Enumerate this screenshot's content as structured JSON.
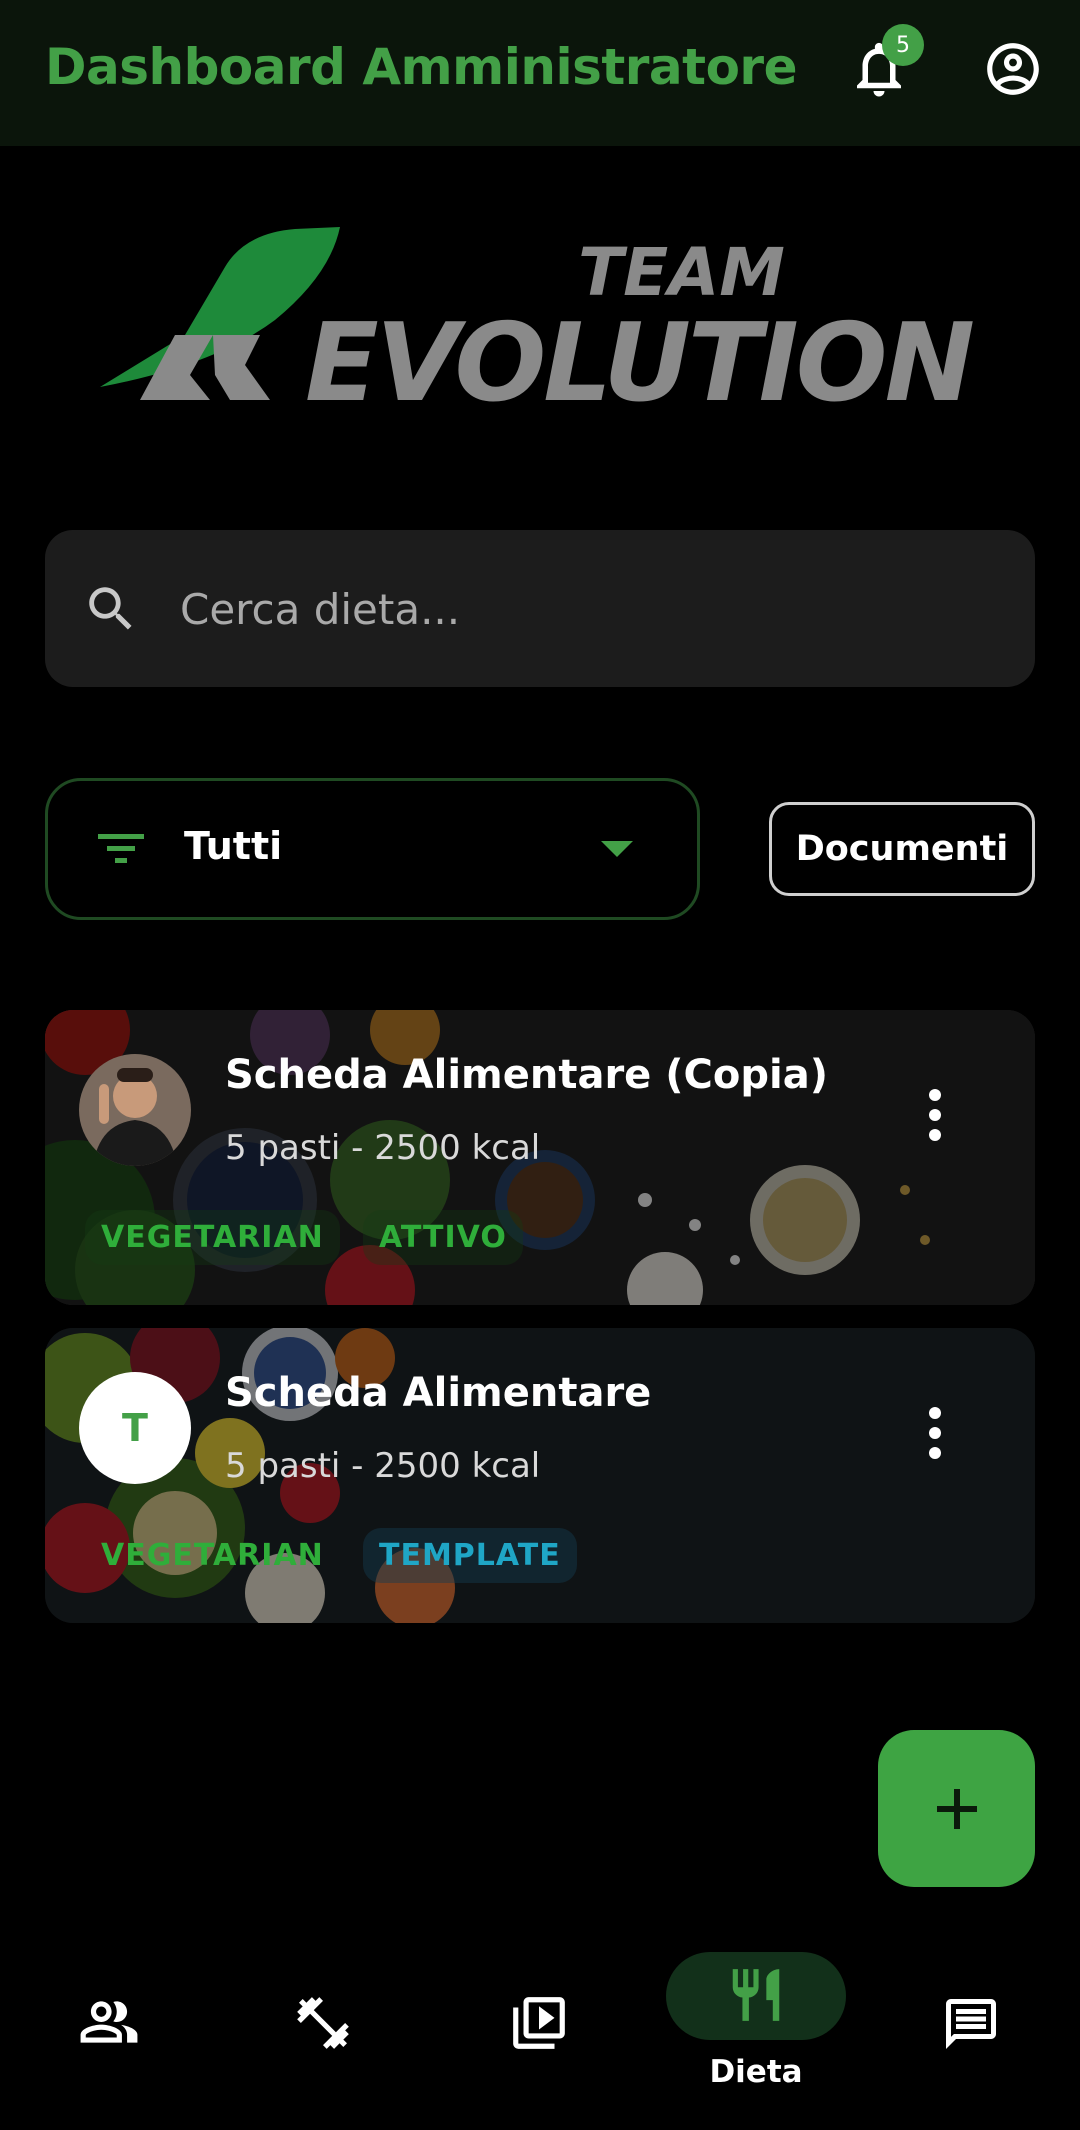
{
  "app_bar": {
    "title": "Dashboard Amministratore",
    "notification_count": "5"
  },
  "logo": {
    "team_text": "TEAM",
    "brand_text": "EVOLUTION",
    "brand_initial": "R"
  },
  "search": {
    "placeholder": "Cerca dieta..."
  },
  "filter": {
    "selected": "Tutti"
  },
  "documents_button": "Documenti",
  "diets": [
    {
      "title": "Scheda Alimentare (Copia)",
      "subtitle": "5 pasti - 2500 kcal",
      "tags": [
        "VEGETARIAN",
        "ATTIVO"
      ],
      "avatar": "photo"
    },
    {
      "title": "Scheda Alimentare",
      "subtitle": "5 pasti - 2500 kcal",
      "tags": [
        "VEGETARIAN",
        "TEMPLATE"
      ],
      "avatar_letter": "T"
    }
  ],
  "bottom_nav": {
    "items": [
      {
        "icon": "people-icon"
      },
      {
        "icon": "dumbbell-icon"
      },
      {
        "icon": "video-library-icon"
      },
      {
        "icon": "restaurant-icon",
        "label": "Dieta",
        "selected": true
      },
      {
        "icon": "chat-icon"
      }
    ]
  },
  "colors": {
    "accent": "#43a047",
    "appbar_bg": "#0b150b",
    "card_tag_green": "#2fae3a",
    "card_tag_blue": "#1fa6c6"
  }
}
